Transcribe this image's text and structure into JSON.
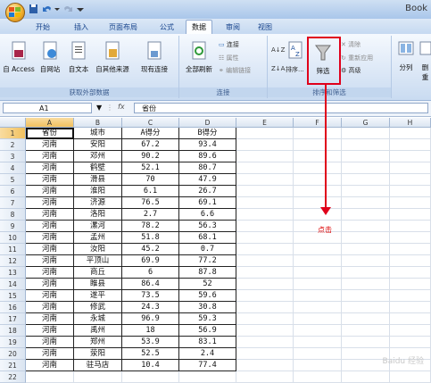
{
  "window": {
    "title": "Book"
  },
  "tabs": [
    "开始",
    "插入",
    "页面布局",
    "公式",
    "数据",
    "审阅",
    "视图"
  ],
  "ribbon": {
    "external_group": {
      "label": "获取外部数据",
      "buttons": [
        "自 Access",
        "自网站",
        "自文本",
        "自其他来源",
        "现有连接"
      ]
    },
    "connections_group": {
      "label": "连接",
      "refresh": "全部刷新",
      "items": [
        "连接",
        "属性",
        "编辑链接"
      ]
    },
    "sort_group": {
      "label": "排序和筛选",
      "sort": "排序...",
      "filter": "筛选",
      "clear": "清除",
      "reapply": "重新应用",
      "advanced": "高级"
    },
    "split": "分列",
    "cut_labels": [
      "删",
      "重"
    ]
  },
  "formula_bar": {
    "cell_ref": "A1",
    "fx": "fx",
    "content": "省份"
  },
  "grid": {
    "columns": [
      "A",
      "B",
      "C",
      "D",
      "E",
      "F",
      "G",
      "H"
    ],
    "headers": [
      "省份",
      "城市",
      "A得分",
      "B得分"
    ],
    "rows": [
      [
        "河南",
        "安阳",
        "67.2",
        "93.4"
      ],
      [
        "河南",
        "邓州",
        "90.2",
        "89.6"
      ],
      [
        "河南",
        "鹤壁",
        "52.1",
        "80.7"
      ],
      [
        "河南",
        "滑县",
        "70",
        "47.9"
      ],
      [
        "河南",
        "淮阳",
        "6.1",
        "26.7"
      ],
      [
        "河南",
        "济源",
        "76.5",
        "69.1"
      ],
      [
        "河南",
        "洛阳",
        "2.7",
        "6.6"
      ],
      [
        "河南",
        "漯河",
        "78.2",
        "56.3"
      ],
      [
        "河南",
        "孟州",
        "51.8",
        "68.1"
      ],
      [
        "河南",
        "汝阳",
        "45.2",
        "0.7"
      ],
      [
        "河南",
        "平顶山",
        "69.9",
        "77.2"
      ],
      [
        "河南",
        "商丘",
        "6",
        "87.8"
      ],
      [
        "河南",
        "睢县",
        "86.4",
        "52"
      ],
      [
        "河南",
        "遂平",
        "73.5",
        "59.6"
      ],
      [
        "河南",
        "修武",
        "24.3",
        "30.8"
      ],
      [
        "河南",
        "永城",
        "96.9",
        "59.3"
      ],
      [
        "河南",
        "禹州",
        "18",
        "56.9"
      ],
      [
        "河南",
        "郑州",
        "53.9",
        "83.1"
      ],
      [
        "河南",
        "荥阳",
        "52.5",
        "2.4"
      ],
      [
        "河南",
        "驻马店",
        "10.4",
        "77.4"
      ]
    ]
  },
  "annotation": {
    "note": "点击"
  },
  "watermark": "Baidu 经验",
  "colors": {
    "annotation_red": "#e0001b",
    "selection": "#f1c15f"
  }
}
